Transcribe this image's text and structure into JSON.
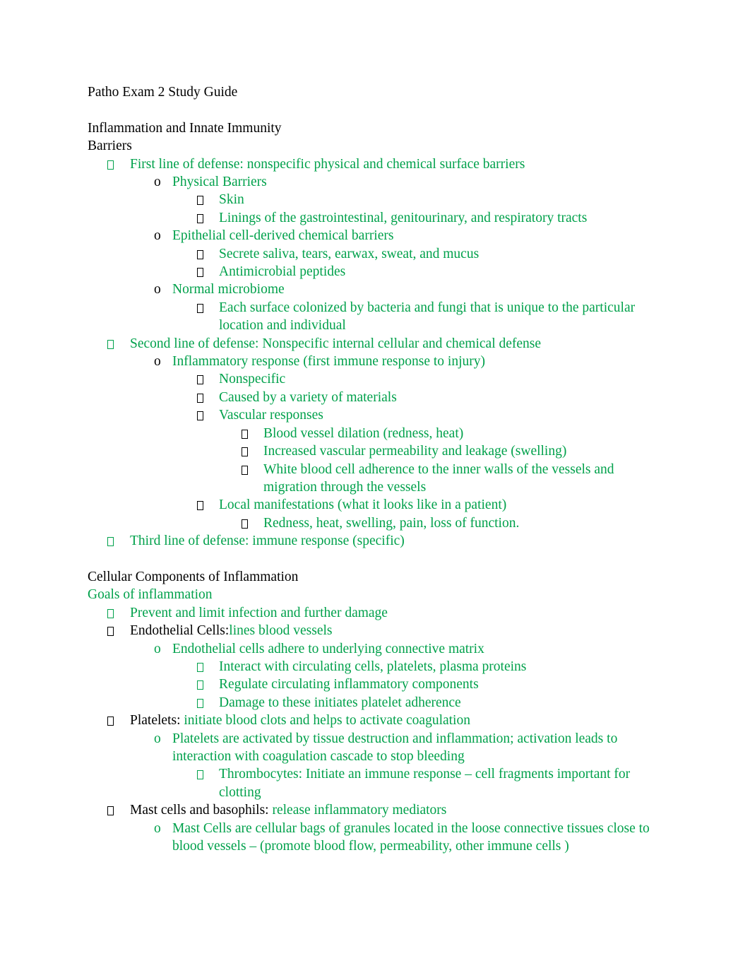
{
  "document": {
    "title": "Patho Exam 2 Study Guide",
    "colors": {
      "text_black": "#000000",
      "text_green": "#00A14B",
      "page_background": "#FFFFFF"
    },
    "markers": {
      "level1": "tofu-box",
      "level2": "o",
      "level3": "tofu-box",
      "level4": "tofu-box"
    },
    "sections": [
      {
        "heading1": "Inflammation and Innate Immunity",
        "heading2": "Barriers"
      },
      {
        "heading1": "Cellular Components of Inflammation",
        "heading2": "Goals of inflammation"
      }
    ],
    "lines": {
      "title": "Patho Exam 2 Study Guide",
      "inflammation_heading": "Inflammation and Innate Immunity",
      "barriers_heading": "Barriers",
      "first_line_of_defense": "First line of defense:  nonspecific physical and chemical surface barriers",
      "physical_barriers": "Physical Barriers",
      "skin": "Skin",
      "linings": "Linings of the gastrointestinal, genitourinary, and respiratory tracts",
      "epithelial_chemical": "Epithelial cell-derived chemical barriers",
      "secrete_saliva": "Secrete saliva, tears, earwax, sweat, and mucus",
      "antimicrobial_peptides": "Antimicrobial peptides",
      "normal_microbiome": "Normal microbiome",
      "each_surface": "Each surface colonized by bacteria and fungi that is unique to the particular location and individual",
      "second_line_of_defense": "Second line of defense:  Nonspecific internal cellular and chemical defense",
      "inflammatory_response": "Inflammatory response (first immune response to injury)",
      "nonspecific": "Nonspecific",
      "caused_by_variety": "Caused by a variety of materials",
      "vascular_responses": "Vascular responses",
      "blood_vessel_dilation": "Blood vessel dilation (redness, heat)",
      "increased_permeability": "Increased vascular permeability and leakage (swelling)",
      "wbc_adherence": "White blood cell adherence to the inner walls of the vessels and migration through the vessels",
      "local_manifestations": "Local manifestations (what it looks like in a patient)",
      "redness_heat": "Redness, heat, swelling, pain, loss of function.",
      "third_line_of_defense": "Third line of defense:  immune response (specific)",
      "cellular_components_heading": "Cellular Components of Inflammation",
      "goals_of_inflammation_heading": "Goals of inflammation",
      "prevent_and_limit": "Prevent and limit infection and further damage",
      "endothelial_cells_label": "Endothelial Cells:",
      "endothelial_cells_desc": "lines blood vessels",
      "endothelial_adhere": "Endothelial cells adhere to underlying connective matrix",
      "interact_with": "Interact with circulating cells, platelets, plasma proteins",
      "regulate_circulating": "Regulate circulating inflammatory components",
      "damage_to_these": "Damage to these initiates platelet adherence",
      "platelets_label": "Platelets: ",
      "platelets_desc": "initiate blood clots and helps to activate coagulation",
      "platelets_activated": "Platelets  are activated by tissue destruction and inflammation; activation leads to interaction with coagulation cascade to stop bleeding",
      "thrombocytes": "Thrombocytes: Initiate an immune response – cell fragments important for clotting",
      "mast_cells_label": "Mast cells and basophils: ",
      "mast_cells_desc": "release inflammatory mediators",
      "mast_cells_bags": "Mast Cells are cellular bags of granules located in the loose connective tissues close to blood vessels – (promote blood flow, permeability, other immune cells )"
    }
  }
}
